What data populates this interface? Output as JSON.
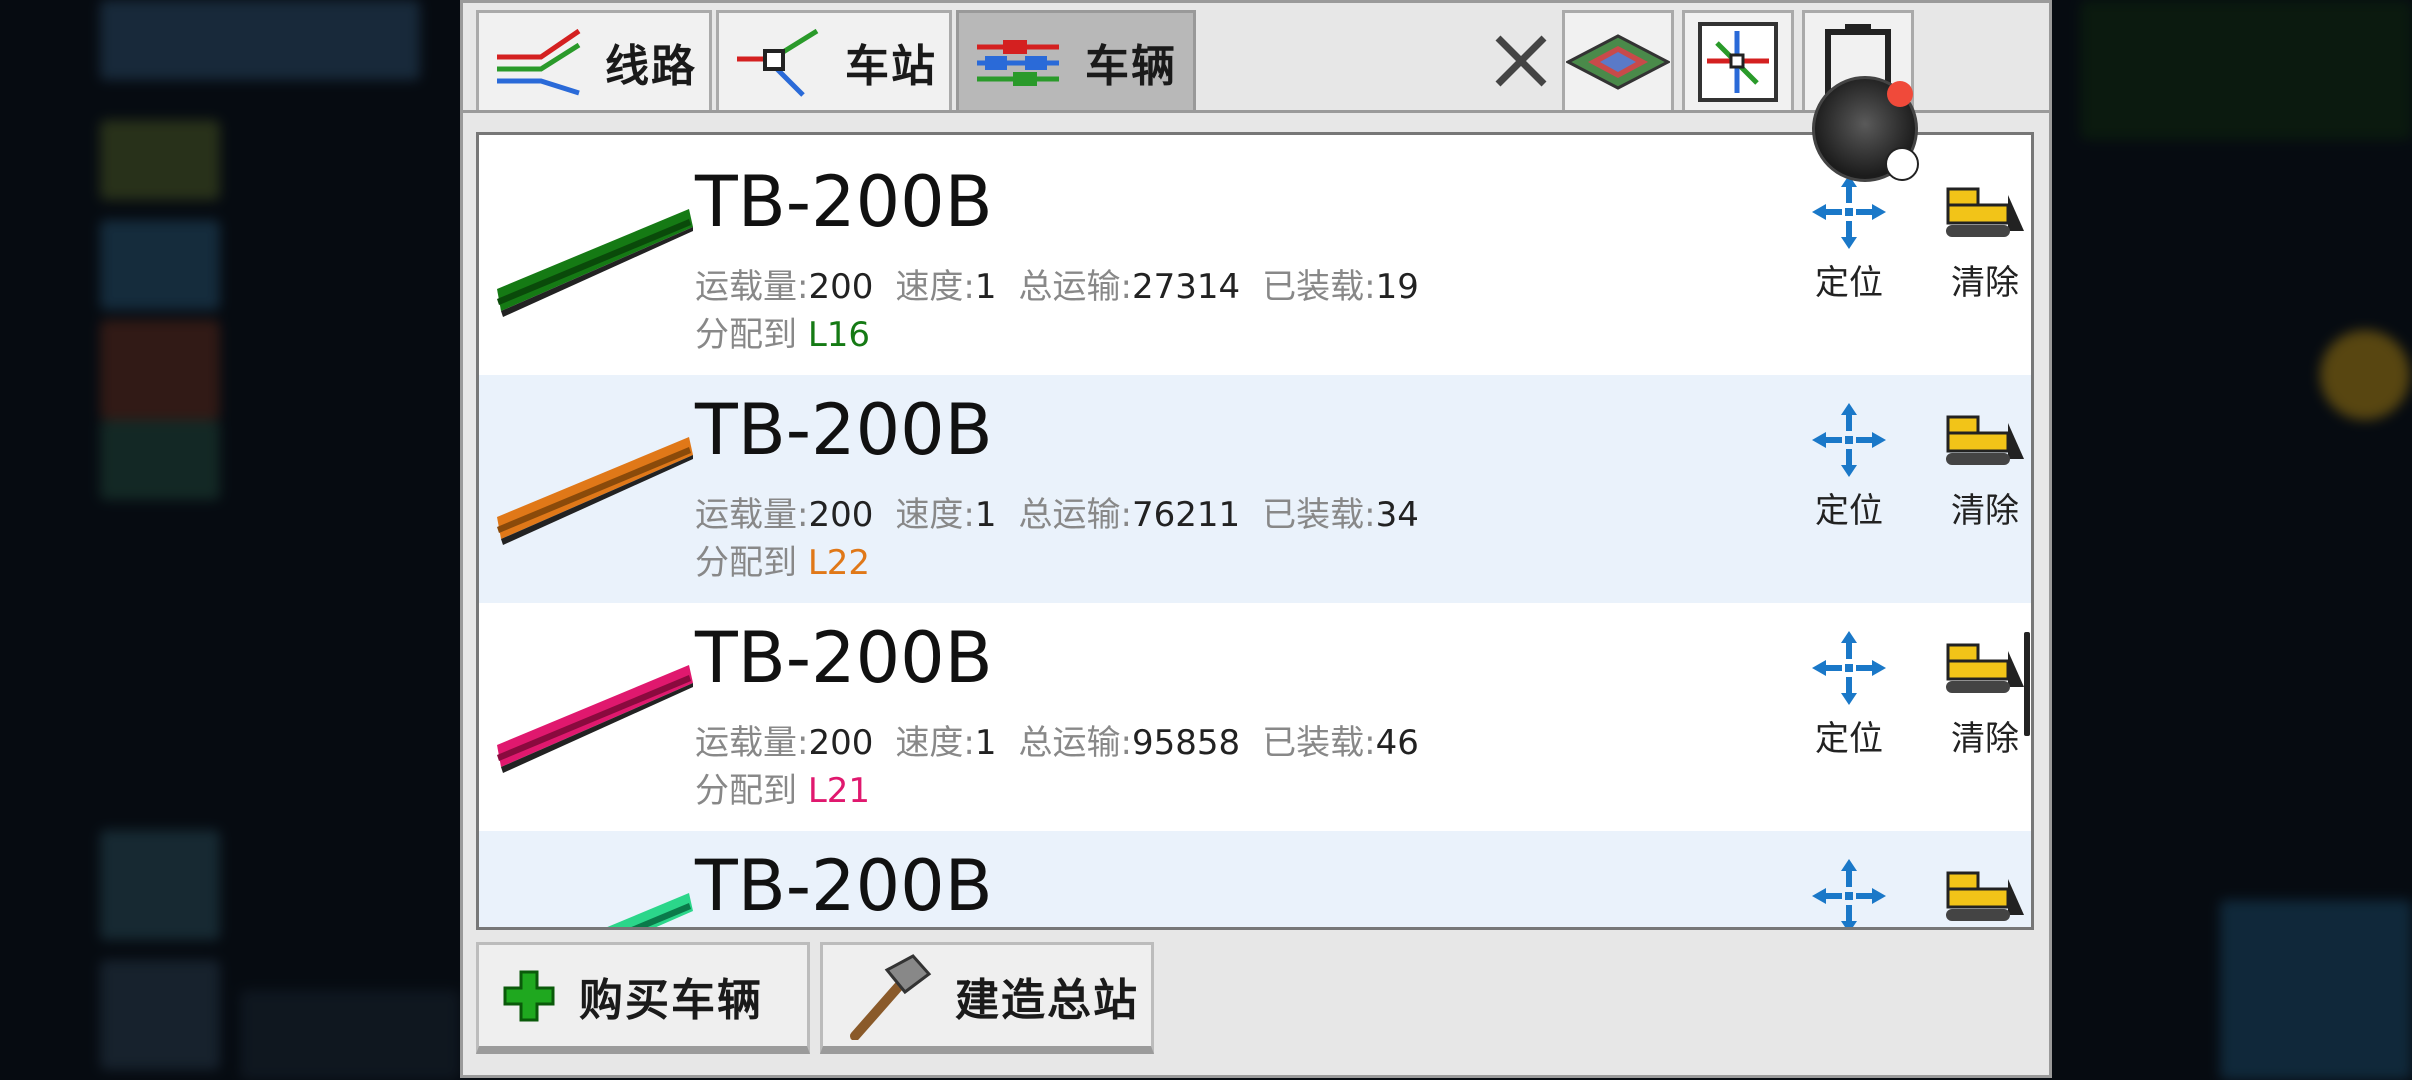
{
  "tabs": [
    {
      "label": "线路"
    },
    {
      "label": "车站"
    },
    {
      "label": "车辆"
    }
  ],
  "vehicles": [
    {
      "model": "TB-200B",
      "capacity_label": "运载量:",
      "capacity": "200",
      "speed_label": "速度:",
      "speed": "1",
      "total_label": "总运输:",
      "total": "27314",
      "loaded_label": "已装载:",
      "loaded": "19",
      "assign_label": "分配到",
      "line": "L16",
      "line_color": "#157a14",
      "locate_label": "定位",
      "clear_label": "清除"
    },
    {
      "model": "TB-200B",
      "capacity_label": "运载量:",
      "capacity": "200",
      "speed_label": "速度:",
      "speed": "1",
      "total_label": "总运输:",
      "total": "76211",
      "loaded_label": "已装载:",
      "loaded": "34",
      "assign_label": "分配到",
      "line": "L22",
      "line_color": "#e07818",
      "locate_label": "定位",
      "clear_label": "清除"
    },
    {
      "model": "TB-200B",
      "capacity_label": "运载量:",
      "capacity": "200",
      "speed_label": "速度:",
      "speed": "1",
      "total_label": "总运输:",
      "total": "95858",
      "loaded_label": "已装载:",
      "loaded": "46",
      "assign_label": "分配到",
      "line": "L21",
      "line_color": "#e0186e",
      "locate_label": "定位",
      "clear_label": "清除"
    },
    {
      "model": "TB-200B",
      "line_color": "#2bd68a"
    }
  ],
  "buttons": {
    "buy_vehicle": "购买车辆",
    "build_depot": "建造总站"
  },
  "colors": {
    "accent_blue": "#1a78c8",
    "bulldozer_yellow": "#f2c418",
    "notification_red": "#f04a3a"
  },
  "icons": {
    "tab_lines": "lines-icon",
    "tab_stations": "station-icon",
    "tab_vehicles": "vehicles-icon",
    "map_view": "isometric-map-icon",
    "metro_map": "metro-map-icon",
    "battery": "battery-icon",
    "close": "close-icon",
    "locate": "locate-icon",
    "clear": "bulldozer-icon",
    "buy": "plus-icon",
    "build": "hammer-icon"
  }
}
